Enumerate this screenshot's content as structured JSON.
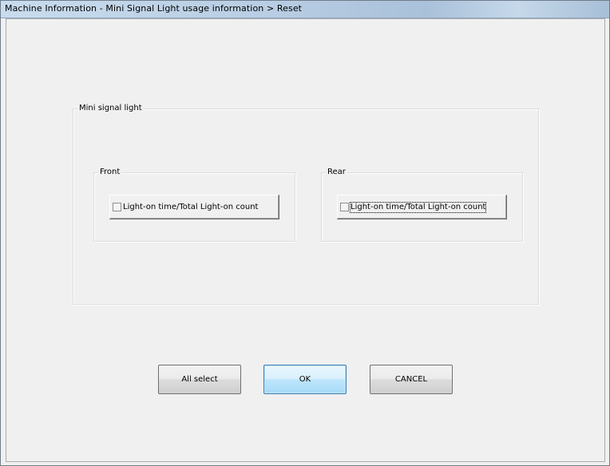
{
  "window": {
    "title": "Machine Information - Mini Signal Light usage information > Reset"
  },
  "mini_signal_light": {
    "label": "Mini signal light",
    "front": {
      "label": "Front",
      "checkbox_label": "Light-on time/Total Light-on count",
      "checked": false
    },
    "rear": {
      "label": "Rear",
      "checkbox_label": "Light-on time/Total Light-on count",
      "checked": false
    }
  },
  "buttons": {
    "all_select": "All select",
    "ok": "OK",
    "cancel": "CANCEL"
  }
}
